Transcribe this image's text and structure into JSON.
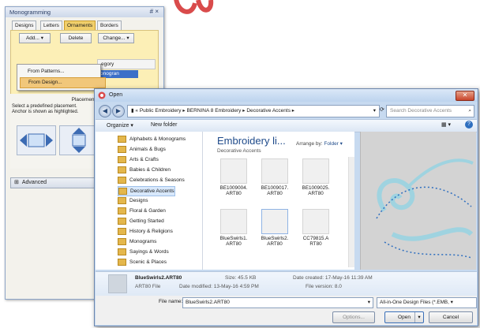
{
  "monogramming": {
    "title": "Monogramming",
    "pin_close": "# ×",
    "tabs": [
      "Designs",
      "Letters",
      "Ornaments",
      "Borders"
    ],
    "active_tab": "Ornaments",
    "toolbar": {
      "add": "Add...",
      "delete": "Delete",
      "change": "Change..."
    },
    "menu": [
      {
        "label": "From Patterns..."
      },
      {
        "label": "From Design...",
        "highlighted": true
      }
    ],
    "category_header": "egory",
    "category_selected": "onogran",
    "placement_heading": "Placement",
    "placement_desc": "Select a predefined placement.\nAnchor is shown as highlighted.",
    "advanced_label": "Advanced"
  },
  "open_dialog": {
    "title": "Open",
    "breadcrumb": [
      "Public Embroidery",
      "BERNINA 8 Embroidery",
      "Decorative Accents"
    ],
    "search_placeholder": "Search Decorative Accents",
    "commands": {
      "organize": "Organize ▾",
      "new_folder": "New folder"
    },
    "folders": [
      {
        "name": "Alphabets & Monograms"
      },
      {
        "name": "Animals & Bugs"
      },
      {
        "name": "Arts & Crafts"
      },
      {
        "name": "Babies & Children"
      },
      {
        "name": "Celebrations & Seasons"
      },
      {
        "name": "Decorative Accents",
        "selected": true
      },
      {
        "name": "Designs"
      },
      {
        "name": "Floral & Garden"
      },
      {
        "name": "Getting Started"
      },
      {
        "name": "History & Religions"
      },
      {
        "name": "Monograms"
      },
      {
        "name": "Sayings & Words"
      },
      {
        "name": "Scenic & Places"
      }
    ],
    "library_title": "Embroidery li...",
    "library_sub": "Decorative Accents",
    "arrange_label": "Arrange by:",
    "arrange_value": "Folder ▾",
    "files": [
      {
        "name": "BE1009004.\nART80"
      },
      {
        "name": "BE1009017.\nART80"
      },
      {
        "name": "BE1009025.\nART80"
      },
      {
        "name": "BlueSwirls1.\nART80"
      },
      {
        "name": "BlueSwirls2.\nART80",
        "selected": true
      },
      {
        "name": "CC79815.A\nRT80"
      }
    ],
    "details": {
      "name": "BlueSwirls2.ART80",
      "type": "ART80 File",
      "size": "Size: 45.5 KB",
      "created": "Date created: 17-May-16 11:39 AM",
      "modified": "Date modified: 13-May-16 4:59 PM",
      "version": "File version: 8.0"
    },
    "filename_label": "File name:",
    "filename_value": "BlueSwirls2.ART80",
    "filetype_value": "All-in-One Design Files (*.EMB, ▾",
    "options_label": "Options...",
    "open_label": "Open",
    "cancel_label": "Cancel",
    "accent_swirl_color": "#9fd3e0",
    "accent_dots_color": "#2f6fbf"
  }
}
